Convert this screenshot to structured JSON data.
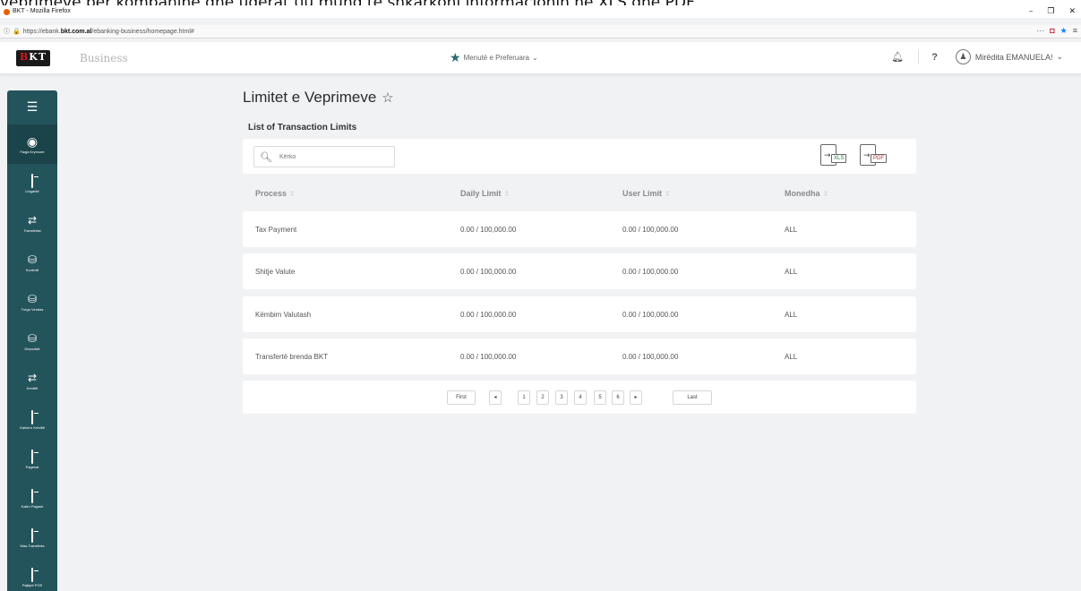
{
  "caption": "veprimeve për kompaninë dhe uderat (ju mund të shkarkoni informacionin në XLS dhe PDF",
  "browser": {
    "title": "BKT - Mozilla Firefox",
    "url_prefix": "https://ebank.",
    "url_domain": "bkt.com.al",
    "url_suffix": "/ebanking-business/homepage.html#",
    "window_controls": [
      "–",
      "❐",
      "✕"
    ]
  },
  "header": {
    "logo": "BKT",
    "product": "Business",
    "favorites": "Menutë e Preferuara",
    "help": "?",
    "user": "Mirëdita EMANUELA!"
  },
  "sidebar": {
    "items": [
      {
        "label": "",
        "icon": "menu-icon"
      },
      {
        "label": "Faqja Kryesore",
        "icon": "home-icon"
      },
      {
        "label": "Llogaritë",
        "icon": "accounts-icon"
      },
      {
        "label": "Transfertat",
        "icon": "transfers-icon"
      },
      {
        "label": "Kontrolli",
        "icon": "control-icon"
      },
      {
        "label": "Tregu Vendas",
        "icon": "market-icon"
      },
      {
        "label": "Depozitat",
        "icon": "deposits-icon"
      },
      {
        "label": "Kreditë",
        "icon": "credits-icon"
      },
      {
        "label": "Kartat e Kreditit",
        "icon": "cards-icon"
      },
      {
        "label": "Pagesat",
        "icon": "payments-icon"
      },
      {
        "label": "Kalim Pagash",
        "icon": "payroll-icon"
      },
      {
        "label": "Mas-Transferta",
        "icon": "mass-transfer-icon"
      },
      {
        "label": "Pajisjet POS",
        "icon": "pos-icon"
      }
    ]
  },
  "main": {
    "title": "Limitet e Veprimeve",
    "section": "List of Transaction Limits",
    "search_placeholder": "Kërko",
    "export_xls": "XLS",
    "export_pdf": "PDF",
    "columns": [
      "Process",
      "Daily Limit",
      "User Limit",
      "Monedha"
    ],
    "rows": [
      {
        "process": "Tax Payment",
        "daily": "0.00 / 100,000.00",
        "user": "0.00 / 100,000.00",
        "currency": "ALL"
      },
      {
        "process": "Shitje Valute",
        "daily": "0.00 / 100,000.00",
        "user": "0.00 / 100,000.00",
        "currency": "ALL"
      },
      {
        "process": "Këmbim Valutash",
        "daily": "0.00 / 100,000.00",
        "user": "0.00 / 100,000.00",
        "currency": "ALL"
      },
      {
        "process": "Transfertë brenda BKT",
        "daily": "0.00 / 100,000.00",
        "user": "0.00 / 100,000.00",
        "currency": "ALL"
      }
    ],
    "pagination": {
      "first": "First",
      "prev": "◂",
      "pages": [
        "1",
        "2",
        "3",
        "4",
        "5",
        "6"
      ],
      "next": "▸",
      "last": "Last"
    }
  }
}
